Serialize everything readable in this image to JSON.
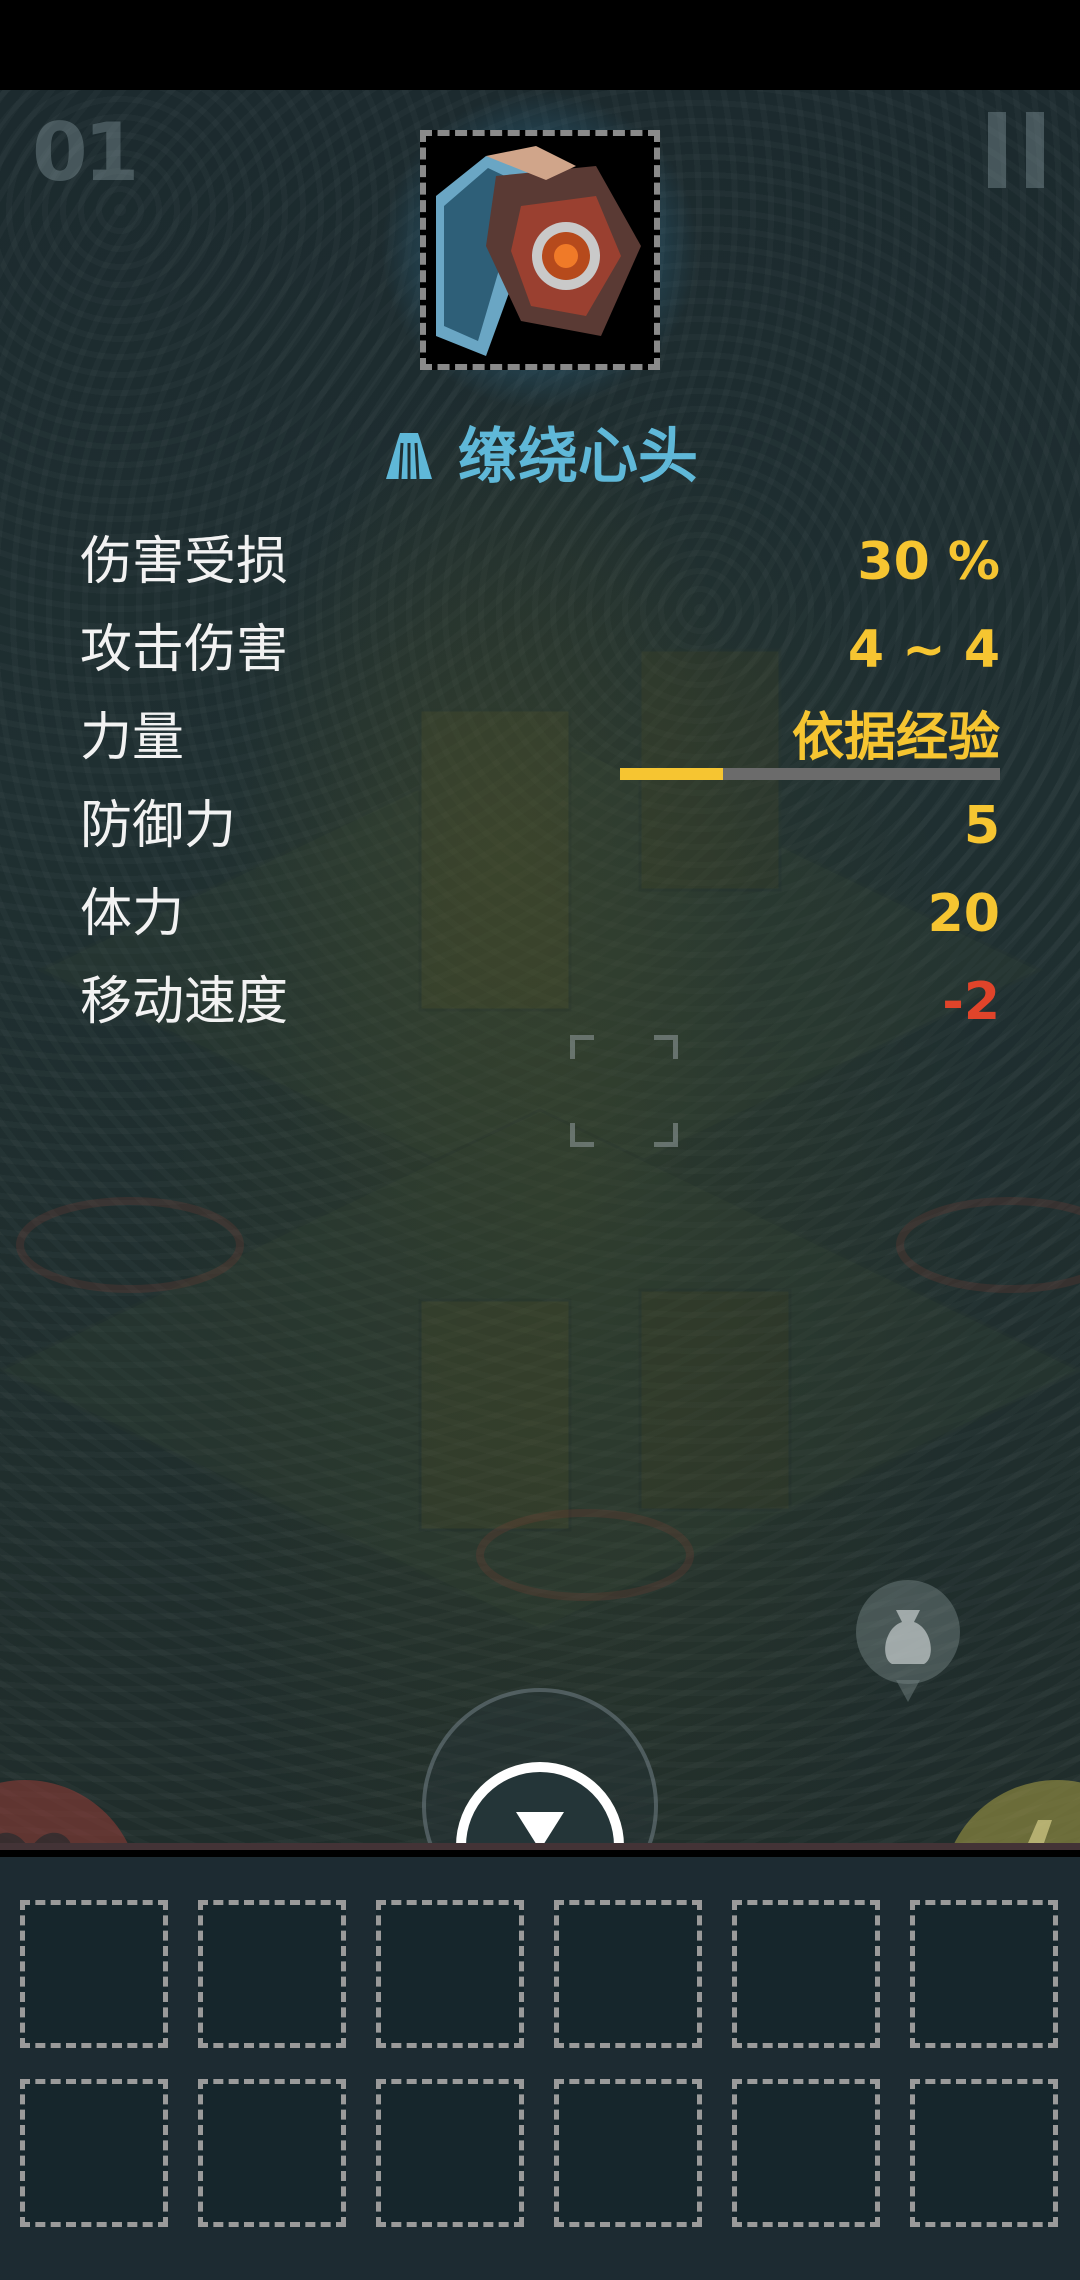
{
  "hud": {
    "wave_counter": "01",
    "pause_icon": "pause-icon"
  },
  "item": {
    "icon": "cloak-item-icon",
    "type_icon": "cloak-icon",
    "name": "缭绕心头",
    "glow_color": "#5ab8e0",
    "name_color": "#5fb8d8"
  },
  "stats": [
    {
      "label": "伤害受损",
      "value": "30 %"
    },
    {
      "label": "攻击伤害",
      "value": "4 ~ 4"
    },
    {
      "label": "力量",
      "value": "依据经验"
    },
    {
      "label": "防御力",
      "value": "5"
    },
    {
      "label": "体力",
      "value": "20"
    },
    {
      "label": "移动速度",
      "value": "-2"
    }
  ],
  "experience_progress": 0.27,
  "colors": {
    "value": "#f6c531",
    "negative": "#e0442a",
    "label": "#f2f2f2"
  },
  "controls": {
    "drop_icon": "drop-item-icon",
    "loot_icon": "loot-bag-icon",
    "heart_icon": "heart-icon",
    "energy_icon": "lightning-icon"
  },
  "inventory": {
    "rows": 2,
    "columns": 6,
    "slots": [
      "",
      "",
      "",
      "",
      "",
      "",
      "",
      "",
      "",
      "",
      "",
      ""
    ]
  }
}
